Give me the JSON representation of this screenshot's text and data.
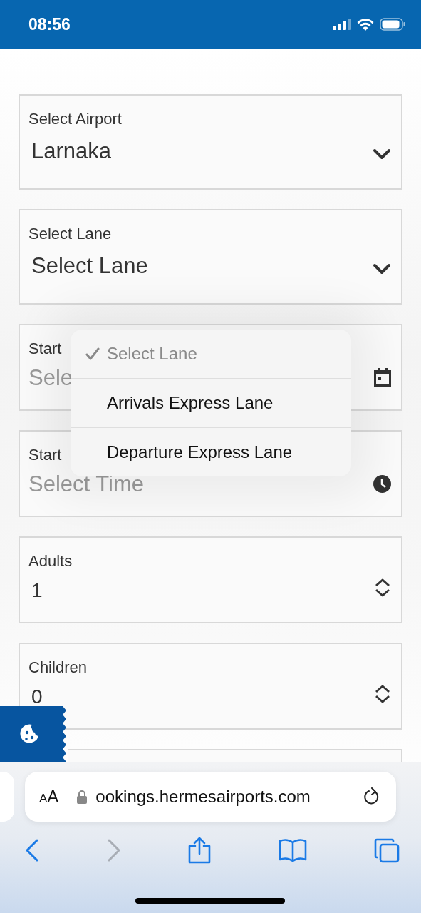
{
  "status_bar": {
    "time": "08:56"
  },
  "fields": [
    {
      "kind": "select",
      "label": "Select Airport",
      "value": "Larnaka"
    },
    {
      "kind": "select",
      "label": "Select Lane",
      "value": "Select Lane"
    },
    {
      "kind": "date",
      "label": "Start",
      "placeholder": "Sele"
    },
    {
      "kind": "time",
      "label": "Start",
      "placeholder": "Select Time"
    },
    {
      "kind": "number",
      "label": "Adults",
      "value": "1"
    },
    {
      "kind": "number",
      "label": "Children",
      "value": "0"
    },
    {
      "kind": "stub"
    }
  ],
  "dropdown": {
    "options": [
      {
        "label": "Select Lane",
        "selected": true
      },
      {
        "label": "Arrivals Express Lane",
        "selected": false
      },
      {
        "label": "Departure Express Lane",
        "selected": false
      }
    ]
  },
  "browser": {
    "text_size_button": "AA",
    "url": "ookings.hermesairports.com",
    "toolbar": [
      {
        "kind": "back",
        "disabled": false
      },
      {
        "kind": "forward",
        "disabled": true
      },
      {
        "kind": "share",
        "disabled": false
      },
      {
        "kind": "bookmarks",
        "disabled": false
      },
      {
        "kind": "tabs",
        "disabled": false
      }
    ]
  }
}
